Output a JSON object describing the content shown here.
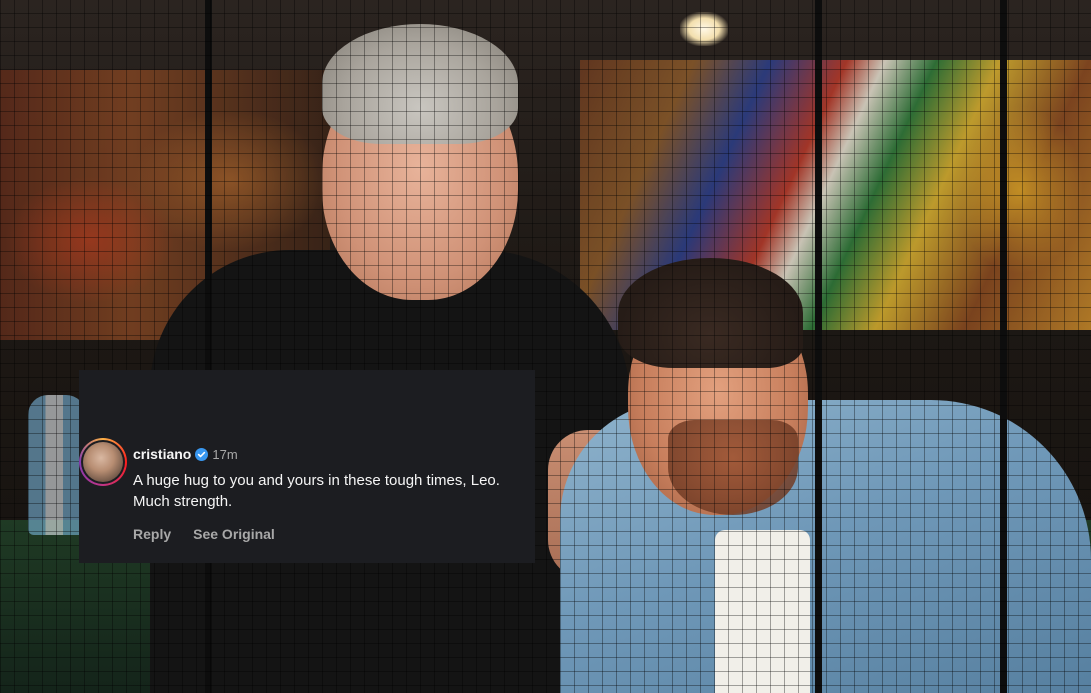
{
  "comment": {
    "username": "cristiano",
    "timestamp": "17m",
    "text": "A huge hug to you and yours in these tough times, Leo. Much strength.",
    "actions": {
      "reply": "Reply",
      "see_original": "See Original"
    },
    "icons": {
      "verified": "verified-badge-icon",
      "avatar": "profile-avatar"
    },
    "colors": {
      "card_background": "#1c1d21",
      "username": "#f5f5f5",
      "muted": "#a8a8a8",
      "verified": "#3897f0"
    }
  }
}
